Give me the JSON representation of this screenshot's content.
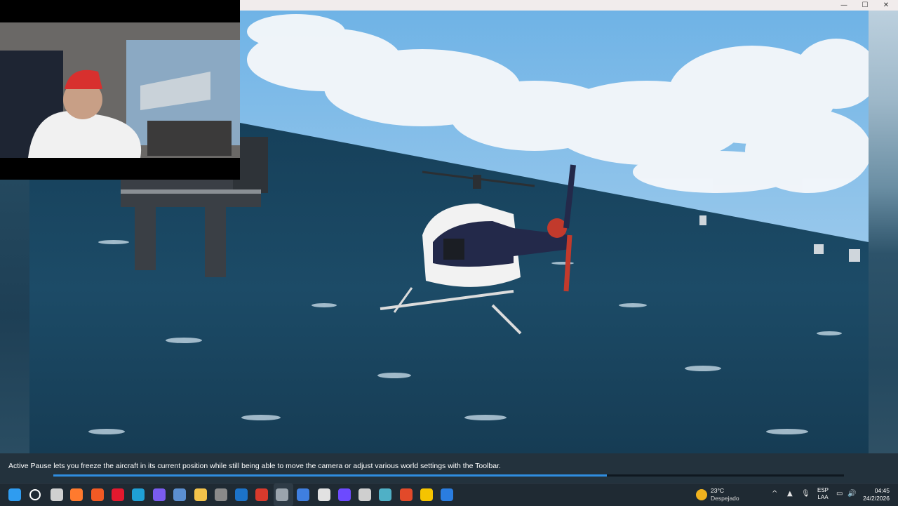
{
  "window": {
    "minimize_glyph": "—",
    "maximize_glyph": "☐",
    "close_glyph": "✕"
  },
  "scene": {
    "content": "flight-simulator-helicopter-over-ocean",
    "sky_color": "#8cc3e8",
    "sea_color": "#1c4a66"
  },
  "webcam": {
    "content": "streamer-webcam"
  },
  "tip": {
    "text": "Active Pause lets you freeze the aircraft in its current position while still being able to move the camera or adjust various world settings with the Toolbar.",
    "progress_percent": 70,
    "progress_color": "#2f8de0"
  },
  "taskbar": {
    "pinned_icons": [
      {
        "name": "windows-start-icon",
        "color": "#2f9cf0"
      },
      {
        "name": "search-icon",
        "color": "#ffffff"
      },
      {
        "name": "task-view-icon",
        "color": "#d0d0d0"
      },
      {
        "name": "firefox-icon",
        "color": "#ff7a2e"
      },
      {
        "name": "brave-icon",
        "color": "#f25a24"
      },
      {
        "name": "opera-icon",
        "color": "#e4192e"
      },
      {
        "name": "edge-icon",
        "color": "#1fa0d6"
      },
      {
        "name": "copilot-icon",
        "color": "#7a5cf0"
      },
      {
        "name": "settings-app-icon",
        "color": "#5b8fd1"
      },
      {
        "name": "file-explorer-icon",
        "color": "#f4c34a"
      },
      {
        "name": "calculator-icon",
        "color": "#8a8a8a"
      },
      {
        "name": "outlook-icon",
        "color": "#1c73c9"
      },
      {
        "name": "news-app-icon",
        "color": "#d93a2c"
      },
      {
        "name": "flight-simulator-icon",
        "color": "#9aa4ad"
      },
      {
        "name": "plus-app-icon",
        "color": "#3f7fe0"
      },
      {
        "name": "chat-app-icon",
        "color": "#e2e2e2"
      },
      {
        "name": "proton-vpn-icon",
        "color": "#6d4aff"
      },
      {
        "name": "obs-studio-icon",
        "color": "#cfcfcf"
      },
      {
        "name": "earth-icon",
        "color": "#4fb0c6"
      },
      {
        "name": "game-launcher-icon",
        "color": "#e24a2a"
      },
      {
        "name": "pac-man-icon",
        "color": "#f5c400"
      },
      {
        "name": "pg-app-icon",
        "color": "#2a7de0"
      }
    ],
    "weather": {
      "temperature": "23°C",
      "description": "Despejado",
      "icon": "moon-icon"
    },
    "tray": {
      "chevron": "^",
      "language_line1": "ESP",
      "language_line2": "LAA",
      "time": "04:45",
      "date": "24/2/2026"
    }
  }
}
